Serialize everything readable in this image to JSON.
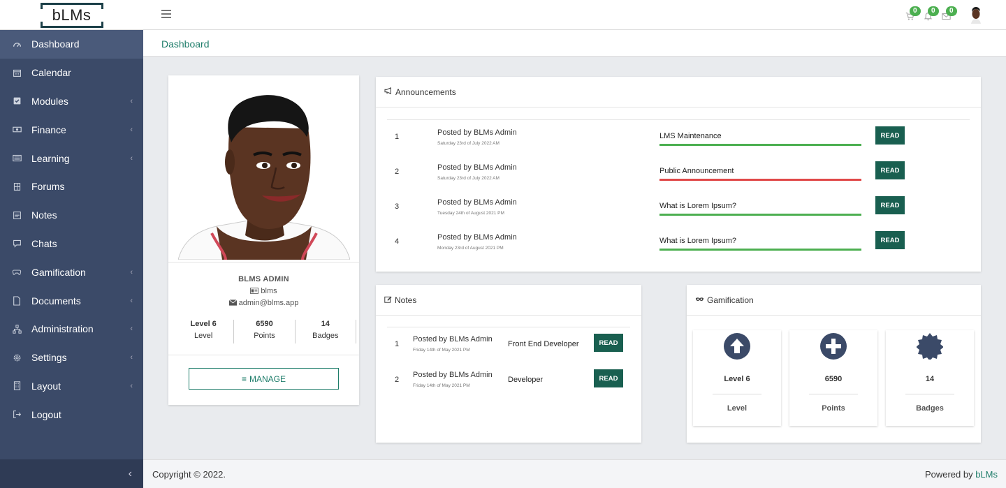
{
  "brand": {
    "logo_text": "bLMs"
  },
  "header": {
    "cart_count": "0",
    "notif_count": "0",
    "mail_count": "0"
  },
  "sidebar": {
    "items": [
      {
        "label": "Dashboard",
        "icon": "dashboard-icon"
      },
      {
        "label": "Calendar",
        "icon": "calendar-icon"
      },
      {
        "label": "Modules",
        "icon": "check-square-icon"
      },
      {
        "label": "Finance",
        "icon": "money-icon"
      },
      {
        "label": "Learning",
        "icon": "list-icon"
      },
      {
        "label": "Forums",
        "icon": "building-icon"
      },
      {
        "label": "Notes",
        "icon": "notes-icon"
      },
      {
        "label": "Chats",
        "icon": "chat-icon"
      },
      {
        "label": "Gamification",
        "icon": "gamepad-icon"
      },
      {
        "label": "Documents",
        "icon": "file-icon"
      },
      {
        "label": "Administration",
        "icon": "sitemap-icon"
      },
      {
        "label": "Settings",
        "icon": "gear-icon"
      },
      {
        "label": "Layout",
        "icon": "layout-icon"
      },
      {
        "label": "Logout",
        "icon": "logout-icon"
      }
    ],
    "chevron": "‹",
    "collapse": "‹"
  },
  "breadcrumb": {
    "label": "Dashboard"
  },
  "profile": {
    "name": "BLMS ADMIN",
    "username": "blms",
    "email": "admin@blms.app",
    "stats": [
      {
        "value": "Level 6",
        "label": "Level"
      },
      {
        "value": "6590",
        "label": "Points"
      },
      {
        "value": "14",
        "label": "Badges"
      }
    ],
    "manage_label": "MANAGE"
  },
  "announcements": {
    "title": "Announcements",
    "read_label": "READ",
    "rows": [
      {
        "num": "1",
        "by": "Posted by BLMs Admin",
        "date": "Saturday 23rd of July 2022 AM",
        "title": "LMS Maintenance",
        "status_color": "#4caf50"
      },
      {
        "num": "2",
        "by": "Posted by BLMs Admin",
        "date": "Saturday 23rd of July 2022 AM",
        "title": "Public Announcement",
        "status_color": "#e04848"
      },
      {
        "num": "3",
        "by": "Posted by BLMs Admin",
        "date": "Tuesday 24th of August 2021 PM",
        "title": "What is Lorem Ipsum?",
        "status_color": "#4caf50"
      },
      {
        "num": "4",
        "by": "Posted by BLMs Admin",
        "date": "Monday 23rd of August 2021 PM",
        "title": "What is Lorem Ipsum?",
        "status_color": "#4caf50"
      }
    ]
  },
  "notes": {
    "title": "Notes",
    "read_label": "READ",
    "rows": [
      {
        "num": "1",
        "by": "Posted by BLMs Admin",
        "date": "Friday 14th of May 2021 PM",
        "title": "Front End Developer"
      },
      {
        "num": "2",
        "by": "Posted by BLMs Admin",
        "date": "Friday 14th of May 2021 PM",
        "title": "Developer"
      }
    ]
  },
  "gamification": {
    "title": "Gamification",
    "cards": [
      {
        "value": "Level 6",
        "label": "Level",
        "icon": "arrow-up-circle-icon"
      },
      {
        "value": "6590",
        "label": "Points",
        "icon": "plus-circle-icon"
      },
      {
        "value": "14",
        "label": "Badges",
        "icon": "badge-icon"
      }
    ]
  },
  "footer": {
    "copyright": "Copyright © 2022.",
    "powered_prefix": "Powered by ",
    "powered_brand": "bLMs"
  },
  "colors": {
    "sidebar": "#3b4a68",
    "accent": "#1e7d6a",
    "button": "#195f50",
    "badge": "#4caf50",
    "alert": "#e04848"
  }
}
